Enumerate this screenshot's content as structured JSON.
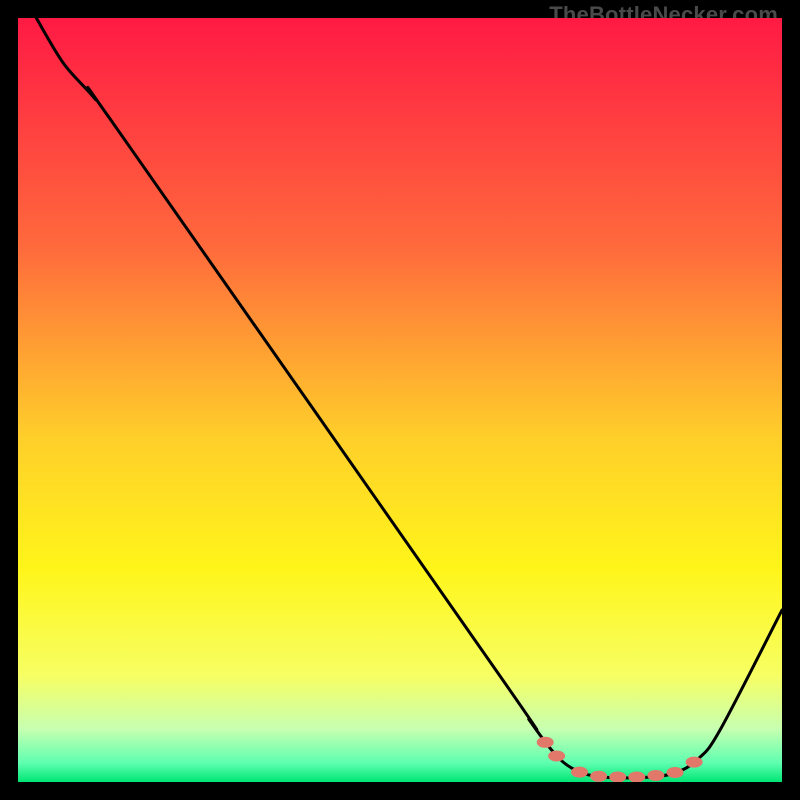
{
  "attribution": "TheBottleNecker.com",
  "chart_data": {
    "type": "line",
    "title": "",
    "xlabel": "",
    "ylabel": "",
    "xlim": [
      0,
      100
    ],
    "ylim": [
      0,
      100
    ],
    "gradient_stops": [
      {
        "offset": 0,
        "color": "#ff1a44"
      },
      {
        "offset": 0.3,
        "color": "#ff6a3c"
      },
      {
        "offset": 0.55,
        "color": "#ffcf2a"
      },
      {
        "offset": 0.72,
        "color": "#fff51a"
      },
      {
        "offset": 0.86,
        "color": "#f7ff63"
      },
      {
        "offset": 0.93,
        "color": "#c8ffb0"
      },
      {
        "offset": 0.975,
        "color": "#5fffb0"
      },
      {
        "offset": 1.0,
        "color": "#00e574"
      }
    ],
    "curve": [
      {
        "x": 2.4,
        "y": 100.0
      },
      {
        "x": 6.0,
        "y": 94.0
      },
      {
        "x": 10.0,
        "y": 89.5
      },
      {
        "x": 14.0,
        "y": 84.0
      },
      {
        "x": 63.0,
        "y": 14.0
      },
      {
        "x": 67.0,
        "y": 8.0
      },
      {
        "x": 70.0,
        "y": 4.0
      },
      {
        "x": 72.5,
        "y": 1.8
      },
      {
        "x": 76.0,
        "y": 0.7
      },
      {
        "x": 82.0,
        "y": 0.6
      },
      {
        "x": 86.0,
        "y": 1.2
      },
      {
        "x": 89.0,
        "y": 3.0
      },
      {
        "x": 92.0,
        "y": 7.0
      },
      {
        "x": 100.0,
        "y": 22.5
      }
    ],
    "highlight_points": [
      {
        "x": 69.0,
        "y": 5.2
      },
      {
        "x": 70.5,
        "y": 3.4
      },
      {
        "x": 73.5,
        "y": 1.3
      },
      {
        "x": 76.0,
        "y": 0.75
      },
      {
        "x": 78.5,
        "y": 0.65
      },
      {
        "x": 81.0,
        "y": 0.65
      },
      {
        "x": 83.5,
        "y": 0.85
      },
      {
        "x": 86.0,
        "y": 1.25
      },
      {
        "x": 88.5,
        "y": 2.6
      }
    ],
    "highlight_color": "#e2786a",
    "curve_color": "#000000"
  }
}
